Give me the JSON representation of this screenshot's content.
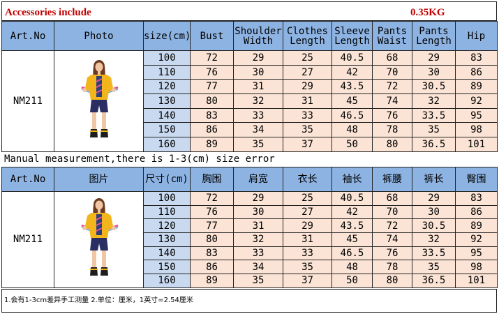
{
  "header": {
    "title": "Accessories include",
    "weight": "0.35KG"
  },
  "table_en": {
    "columns": [
      "Art.No",
      "Photo",
      "size(cm)",
      "Bust",
      "Shoulder Width",
      "Clothes Length",
      "Sleeve Length",
      "Pants Waist",
      "Pants Length",
      "Hip"
    ],
    "art_no": "NM211"
  },
  "note": "Manual measurement,there is 1-3(cm) size error",
  "table_cn": {
    "columns": [
      "Art.No",
      "图片",
      "尺寸(cm)",
      "胸围",
      "肩宽",
      "衣长",
      "袖长",
      "裤腰",
      "裤长",
      "臀围"
    ],
    "art_no": "NM211"
  },
  "rows": [
    [
      "100",
      "72",
      "29",
      "25",
      "40.5",
      "68",
      "29",
      "83"
    ],
    [
      "110",
      "76",
      "30",
      "27",
      "42",
      "70",
      "30",
      "86"
    ],
    [
      "120",
      "77",
      "31",
      "29",
      "43.5",
      "72",
      "30.5",
      "89"
    ],
    [
      "130",
      "80",
      "32",
      "31",
      "45",
      "74",
      "32",
      "92"
    ],
    [
      "140",
      "83",
      "33",
      "33",
      "46.5",
      "76",
      "33.5",
      "95"
    ],
    [
      "150",
      "86",
      "34",
      "35",
      "48",
      "78",
      "35",
      "98"
    ],
    [
      "160",
      "89",
      "35",
      "37",
      "50",
      "80",
      "36.5",
      "101"
    ]
  ],
  "footer": "1.会有1-3cm差异手工测量  2.单位：厘米，1英寸=2.54厘米",
  "colors": {
    "header_blue": "#8db3e2",
    "size_blue": "#c9daf0",
    "value_peach": "#fbe4d5",
    "title_red": "#c00000"
  }
}
